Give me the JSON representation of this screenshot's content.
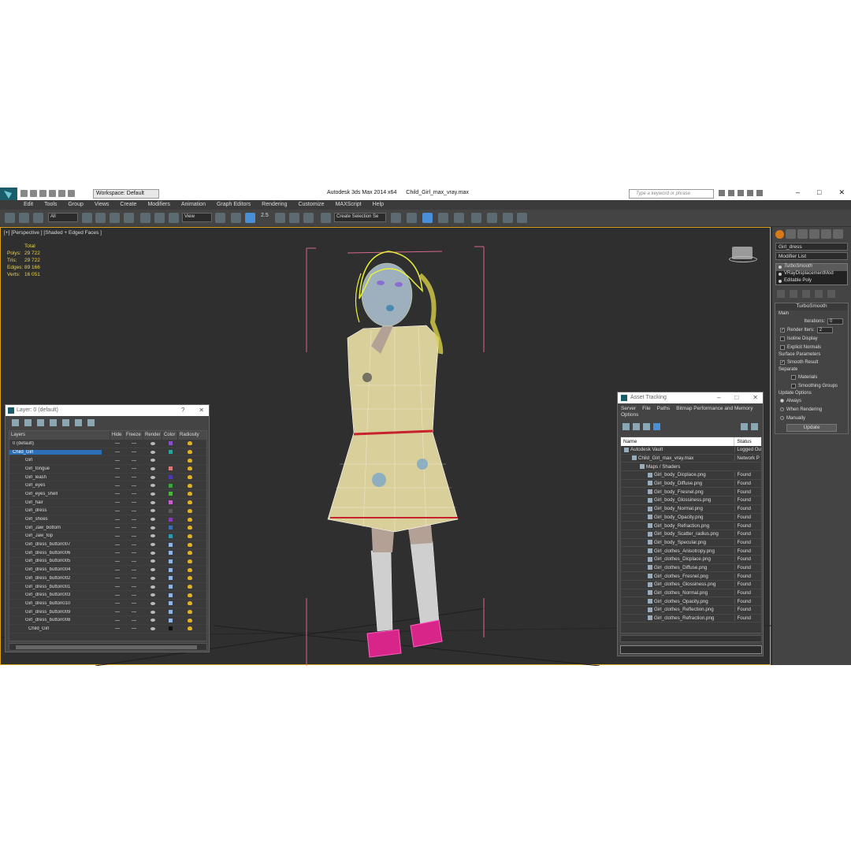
{
  "window": {
    "app_title": "Autodesk 3ds Max  2014 x64",
    "file_title": "Child_Girl_max_vray.max",
    "workspace": "Workspace: Default",
    "search_placeholder": "Type a keyword or phrase",
    "minimize": "–",
    "maximize": "□",
    "close": "✕"
  },
  "menu": [
    "Edit",
    "Tools",
    "Group",
    "Views",
    "Create",
    "Modifiers",
    "Animation",
    "Graph Editors",
    "Rendering",
    "Customize",
    "MAXScript",
    "Help"
  ],
  "toolbar": {
    "filter": "All",
    "refcoord": "View",
    "selection_set": "Create Selection Se",
    "angle_snap": "2.5"
  },
  "viewport": {
    "label": "[+] [Perspective ] [Shaded + Edged Faces ]",
    "stats_header": "Total",
    "stats": [
      {
        "label": "Polys:",
        "value": "29 722"
      },
      {
        "label": "Tris:",
        "value": "29 722"
      },
      {
        "label": "Edges:",
        "value": "89 166"
      },
      {
        "label": "Verts:",
        "value": "16 051"
      }
    ]
  },
  "command_panel": {
    "object_name": "Girl_dress",
    "modifier_list": "Modifier List",
    "stack": [
      "TurboSmooth",
      "VRayDisplacementMod",
      "Editable Poly"
    ],
    "rollout_title": "TurboSmooth",
    "main_label": "Main",
    "iterations_label": "Iterations:",
    "iterations_value": "0",
    "render_iters_label": "Render Iters:",
    "render_iters_value": "2",
    "isoline": "Isoline Display",
    "explicit_normals": "Explicit Normals",
    "surface_params": "Surface Parameters",
    "smooth_result": "Smooth Result",
    "separate": "Separate",
    "materials": "Materials",
    "smoothing_groups": "Smoothing Groups",
    "update_options": "Update Options",
    "always": "Always",
    "when_rendering": "When Rendering",
    "manually": "Manually",
    "update_button": "Update"
  },
  "layers_window": {
    "title": "Layer: 0 (default)",
    "help": "?",
    "close": "✕",
    "columns": [
      "Layers",
      "Hide",
      "Freeze",
      "Render",
      "Color",
      "Radiosity"
    ],
    "rows": [
      {
        "name": "0 (default)",
        "color": "#8a4fcf"
      },
      {
        "name": "Child_Girl",
        "color": "#2aa39a",
        "selected": true
      },
      {
        "name": "Girl",
        "color": "#3a3a3a"
      },
      {
        "name": "Girl_tongue",
        "color": "#d97a7a"
      },
      {
        "name": "Girl_leash",
        "color": "#4a3ab5"
      },
      {
        "name": "Girl_eyes",
        "color": "#3aa33a"
      },
      {
        "name": "Girl_eyes_shell",
        "color": "#4ab53a"
      },
      {
        "name": "Girl_hair",
        "color": "#c85fd0"
      },
      {
        "name": "Girl_dress",
        "color": "#5a5a5a"
      },
      {
        "name": "Girl_shoes",
        "color": "#8a3ab5"
      },
      {
        "name": "Girl_Jaw_bottom",
        "color": "#3a6fb5"
      },
      {
        "name": "Girl_Jaw_top",
        "color": "#2a9ab5"
      },
      {
        "name": "Girl_dress_button007",
        "color": "#8fb5e8"
      },
      {
        "name": "Girl_dress_button006",
        "color": "#8fb5e8"
      },
      {
        "name": "Girl_dress_button005",
        "color": "#8fb5e8"
      },
      {
        "name": "Girl_dress_button004",
        "color": "#8fb5e8"
      },
      {
        "name": "Girl_dress_button002",
        "color": "#8fb5e8"
      },
      {
        "name": "Girl_dress_button001",
        "color": "#8fb5e8"
      },
      {
        "name": "Girl_dress_button003",
        "color": "#8fb5e8"
      },
      {
        "name": "Girl_dress_button010",
        "color": "#8fb5e8"
      },
      {
        "name": "Girl_dress_button009",
        "color": "#8fb5e8"
      },
      {
        "name": "Girl_dress_button008",
        "color": "#8fb5e8"
      },
      {
        "name": "Child_Girl",
        "color": "#111111"
      }
    ]
  },
  "asset_tracking": {
    "title": "Asset Tracking",
    "menu": [
      "Server",
      "File",
      "Paths",
      "Bitmap Performance and Memory",
      "Options"
    ],
    "columns": [
      "Name",
      "Status"
    ],
    "rows": [
      {
        "name": "Autodesk Vault",
        "status": "Logged Ou",
        "indent": 1
      },
      {
        "name": "Child_Girl_max_vray.max",
        "status": "Network P",
        "indent": 2
      },
      {
        "name": "Maps / Shaders",
        "status": "",
        "indent": 3
      },
      {
        "name": "Girl_body_Dicplace.png",
        "status": "Found",
        "indent": 4
      },
      {
        "name": "Girl_body_Diffuse.png",
        "status": "Found",
        "indent": 4
      },
      {
        "name": "Girl_body_Fresnel.png",
        "status": "Found",
        "indent": 4
      },
      {
        "name": "Girl_body_Glossiness.png",
        "status": "Found",
        "indent": 4
      },
      {
        "name": "Girl_body_Normal.png",
        "status": "Found",
        "indent": 4
      },
      {
        "name": "Girl_body_Opacity.png",
        "status": "Found",
        "indent": 4
      },
      {
        "name": "Girl_body_Refraction.png",
        "status": "Found",
        "indent": 4
      },
      {
        "name": "Girl_body_Scatter_radius.png",
        "status": "Found",
        "indent": 4
      },
      {
        "name": "Girl_body_Specular.png",
        "status": "Found",
        "indent": 4
      },
      {
        "name": "Girl_clothes_Anisotropy.png",
        "status": "Found",
        "indent": 4
      },
      {
        "name": "Girl_clothes_Dicplace.png",
        "status": "Found",
        "indent": 4
      },
      {
        "name": "Girl_clothes_Diffuse.png",
        "status": "Found",
        "indent": 4
      },
      {
        "name": "Girl_clothes_Fresnel.png",
        "status": "Found",
        "indent": 4
      },
      {
        "name": "Girl_clothes_Glossiness.png",
        "status": "Found",
        "indent": 4
      },
      {
        "name": "Girl_clothes_Normal.png",
        "status": "Found",
        "indent": 4
      },
      {
        "name": "Girl_clothes_Opacity.png",
        "status": "Found",
        "indent": 4
      },
      {
        "name": "Girl_clothes_Reflection.png",
        "status": "Found",
        "indent": 4
      },
      {
        "name": "Girl_clothes_Refraction.png",
        "status": "Found",
        "indent": 4
      }
    ]
  }
}
